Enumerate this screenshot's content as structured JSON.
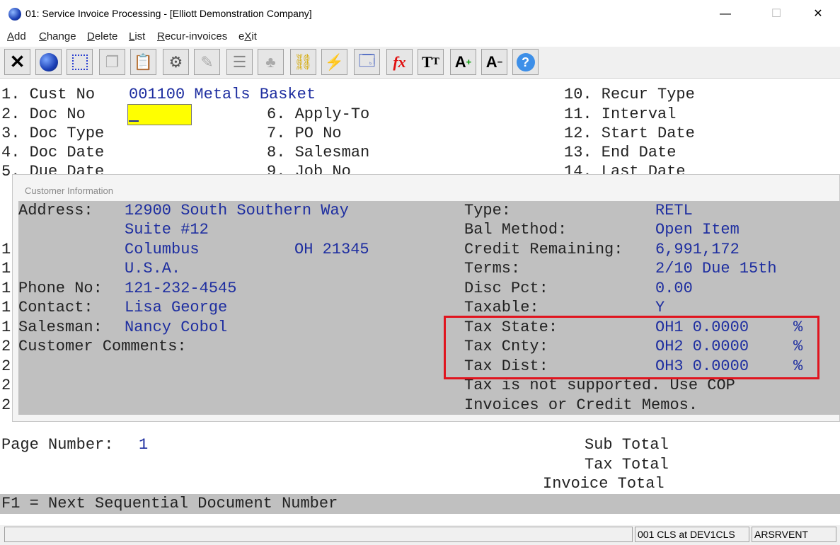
{
  "window": {
    "title": "01: Service Invoice Processing - [Elliott Demonstration Company]",
    "minimize": "—",
    "maximize": "☐",
    "close": "✕"
  },
  "menu": [
    {
      "first": "A",
      "rest": "dd"
    },
    {
      "first": "C",
      "rest": "hange"
    },
    {
      "first": "D",
      "rest": "elete"
    },
    {
      "first": "L",
      "rest": "ist"
    },
    {
      "first": "R",
      "rest": "ecur-invoices"
    },
    {
      "first": "",
      "mid": "e",
      "u": "X",
      "rest": "it"
    }
  ],
  "toolbar": [
    "close-icon",
    "globe-icon",
    "select-icon",
    "copy-icon",
    "paste-icon",
    "settings-icon",
    "edit-icon",
    "list-icon",
    "users-icon",
    "tag-icon",
    "flash-icon",
    "screen-icon",
    "function-icon",
    "text-size-icon",
    "font-increase-icon",
    "font-decrease-icon",
    "help-icon"
  ],
  "form": {
    "f1": "1. Cust No",
    "cust_no": "001100 Metals Basket",
    "f2": "2. Doc No",
    "f3": "3. Doc Type",
    "f4": "4. Doc Date",
    "f5": "5. Due Date",
    "f6": "6. Apply-To",
    "f7": "7. PO No",
    "f8": "8. Salesman",
    "f9": "9. Job No",
    "f10": "10. Recur Type",
    "f11": "11. Interval",
    "f12": "12. Start Date",
    "f13": "13. End Date",
    "f14": "14. Last Date",
    "left_digits": [
      "1",
      "1",
      "1",
      "1",
      "1",
      "2",
      "2",
      "2",
      "2"
    ]
  },
  "popup": {
    "title": "Customer Information",
    "address_label": "Address:",
    "address": [
      "12900 South Southern Way",
      "Suite #12",
      "Columbus",
      "U.S.A."
    ],
    "state_zip": "OH 21345",
    "phone_label": "Phone No:",
    "phone": "121-232-4545",
    "contact_label": "Contact:",
    "contact": "Lisa George",
    "salesman_label": "Salesman:",
    "salesman": "Nancy Cobol",
    "comments_label": "Customer Comments:",
    "type_label": "Type:",
    "type": "RETL",
    "bal_label": "Bal Method:",
    "bal": "Open Item",
    "credit_label": "Credit Remaining:",
    "credit": "6,991,172",
    "terms_label": "Terms:",
    "terms": "2/10 Due 15th",
    "disc_label": "Disc Pct:",
    "disc": "0.00",
    "taxable_label": "Taxable:",
    "taxable": "Y",
    "tax_state_label": "Tax State:",
    "tax_state": "OH1 0.0000",
    "tax_cnty_label": "Tax Cnty:",
    "tax_cnty": "OH2 0.0000",
    "tax_dist_label": "Tax Dist:",
    "tax_dist": "OH3 0.0000",
    "pct": "%",
    "note1": "Tax is not supported. Use COP",
    "note2": "Invoices or Credit Memos."
  },
  "footer": {
    "page_label": "Page Number:",
    "page": "1",
    "sub_total": "Sub Total",
    "tax_total": "Tax Total",
    "invoice_total": "Invoice Total",
    "f1_help": "F1 = Next Sequential Document Number"
  },
  "status": {
    "panel1": "",
    "panel2": "001 CLS at DEV1CLS",
    "panel3": "ARSRVENT"
  }
}
